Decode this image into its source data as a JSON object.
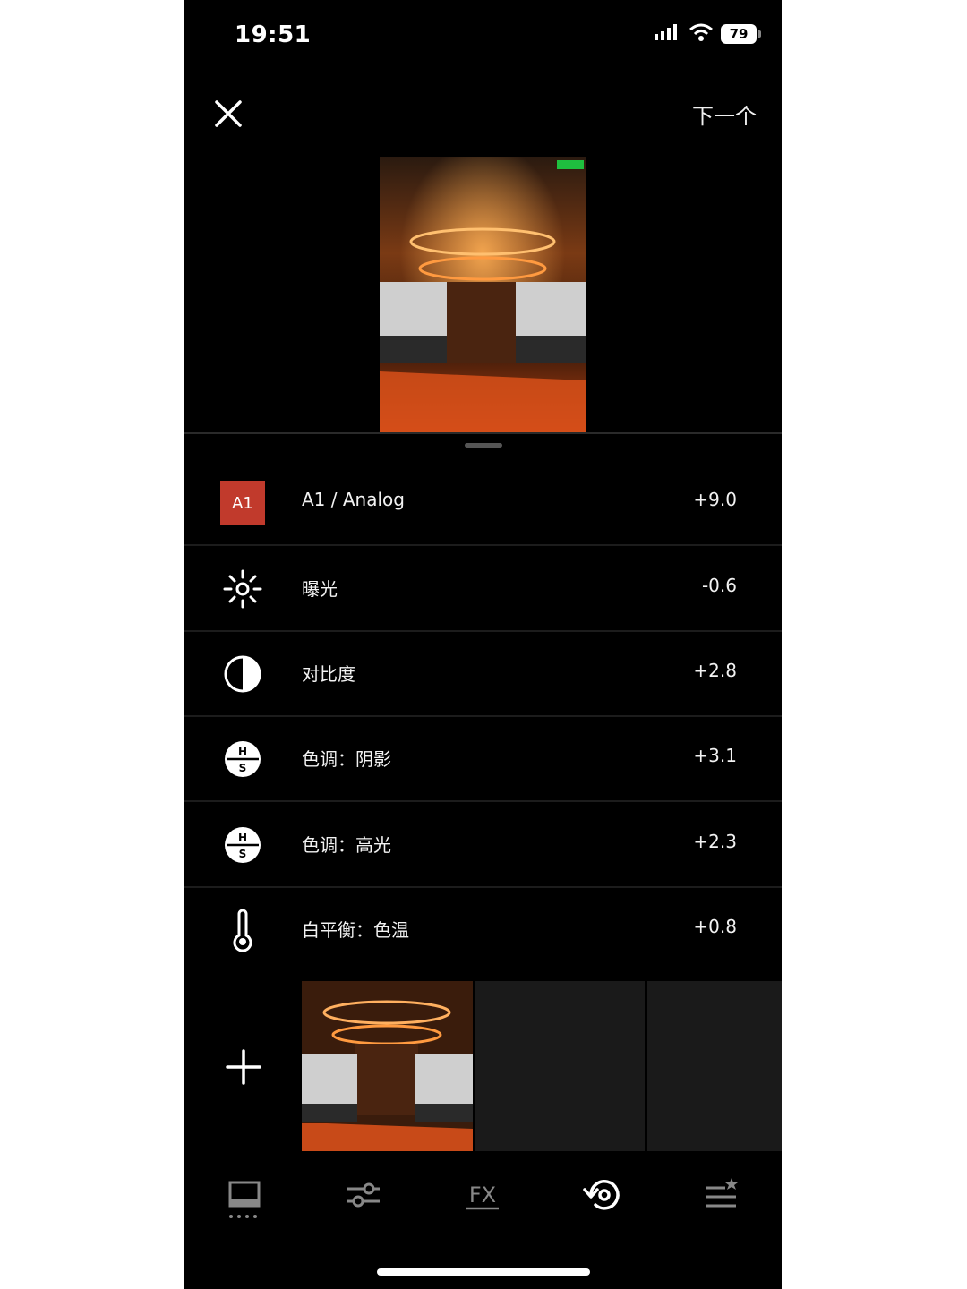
{
  "status_bar": {
    "time": "19:51",
    "battery": "79"
  },
  "header": {
    "next_label": "下一个"
  },
  "adjustments": [
    {
      "icon": "preset-badge",
      "badge": "A1",
      "label": "A1 / Analog",
      "value": "+9.0"
    },
    {
      "icon": "exposure-sun-icon",
      "label": "曝光",
      "value": "-0.6"
    },
    {
      "icon": "contrast-icon",
      "label": "对比度",
      "value": "+2.8"
    },
    {
      "icon": "hsl-icon",
      "label": "色调：阴影",
      "value": "+3.1"
    },
    {
      "icon": "hsl-icon",
      "label": "色调：高光",
      "value": "+2.3"
    },
    {
      "icon": "thermometer-icon",
      "label": "白平衡：色温",
      "value": "+0.8"
    }
  ],
  "hsl_icon_letters": {
    "top": "H",
    "bottom": "S"
  },
  "toolbar": {
    "items": [
      "presets-icon",
      "sliders-icon",
      "fx-icon",
      "history-icon",
      "recipes-icon"
    ],
    "fx_label": "FX"
  },
  "colors": {
    "background": "#000000",
    "accent": "#c13a2c",
    "divider": "#1c1c1c"
  }
}
